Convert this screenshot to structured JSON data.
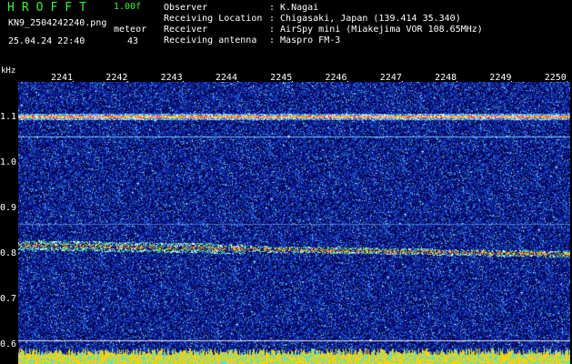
{
  "header": {
    "app_title": "HROFFT",
    "version": "1.00f",
    "filename": "KN9_2504242240.png",
    "meteor_label": "meteor",
    "datetime": "25.04.24 22:40",
    "meteor_count": "43"
  },
  "info": [
    {
      "key": "Observer",
      "value": ": K.Nagai"
    },
    {
      "key": "Receiving Location",
      "value": ": Chigasaki, Japan (139.414 35.340)"
    },
    {
      "key": "Receiver",
      "value": ": AirSpy mini (Miakejima VOR 108.65MHz)"
    },
    {
      "key": "Receiving antenna",
      "value": ": Maspro FM-3"
    }
  ],
  "axis": {
    "y_unit": "kHz",
    "y_ticks": [
      "1.1",
      "1.0",
      "0.9",
      "0.8",
      "0.7",
      "0.6"
    ],
    "y_values": [
      1.1,
      1.0,
      0.9,
      0.8,
      0.7,
      0.6
    ],
    "x_ticks": [
      "2241",
      "2242",
      "2243",
      "2244",
      "2245",
      "2246",
      "2247",
      "2248",
      "2249",
      "2250"
    ]
  },
  "spectrogram": {
    "carrier_lines_khz": [
      1.102,
      1.058,
      0.867,
      0.8
    ],
    "meteor_trail": {
      "from_khz": 0.82,
      "to_khz": 0.8,
      "start_minute": "2241",
      "end_minute": "2250"
    }
  },
  "colors": {
    "background": "#000000",
    "title_green": "#3cf03c",
    "noise_blue": "#1e3cc8",
    "signal_yellow": "#ffd200",
    "signal_red": "#ff3c3c",
    "scale_line": "#e6e6e6"
  }
}
